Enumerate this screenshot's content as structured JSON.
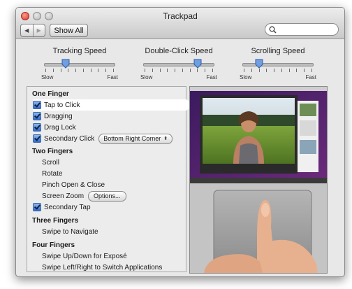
{
  "window": {
    "title": "Trackpad"
  },
  "toolbar": {
    "show_all_label": "Show All",
    "back_icon": "back-arrow-icon",
    "forward_icon": "forward-arrow-icon",
    "search_placeholder": ""
  },
  "sliders": [
    {
      "title": "Tracking Speed",
      "min_label": "Slow",
      "max_label": "Fast",
      "value": 0.3
    },
    {
      "title": "Double-Click Speed",
      "min_label": "Slow",
      "max_label": "Fast",
      "value": 0.78
    },
    {
      "title": "Scrolling Speed",
      "min_label": "Slow",
      "max_label": "Fast",
      "value": 0.22
    }
  ],
  "gestures": {
    "one_finger": {
      "header": "One Finger",
      "tap_to_click": "Tap to Click",
      "dragging": "Dragging",
      "drag_lock": "Drag Lock",
      "secondary_click": "Secondary Click",
      "secondary_click_option": "Bottom Right Corner"
    },
    "two_fingers": {
      "header": "Two Fingers",
      "scroll": "Scroll",
      "rotate": "Rotate",
      "pinch": "Pinch Open & Close",
      "screen_zoom": "Screen Zoom",
      "options_label": "Options...",
      "secondary_tap": "Secondary Tap"
    },
    "three_fingers": {
      "header": "Three Fingers",
      "swipe": "Swipe to Navigate"
    },
    "four_fingers": {
      "header": "Four Fingers",
      "expose": "Swipe Up/Down for Exposé",
      "switch_apps": "Swipe Left/Right to Switch Applications"
    }
  },
  "colors": {
    "checkbox_accent": "#2f6ad0",
    "close_button": "#d8392a"
  }
}
